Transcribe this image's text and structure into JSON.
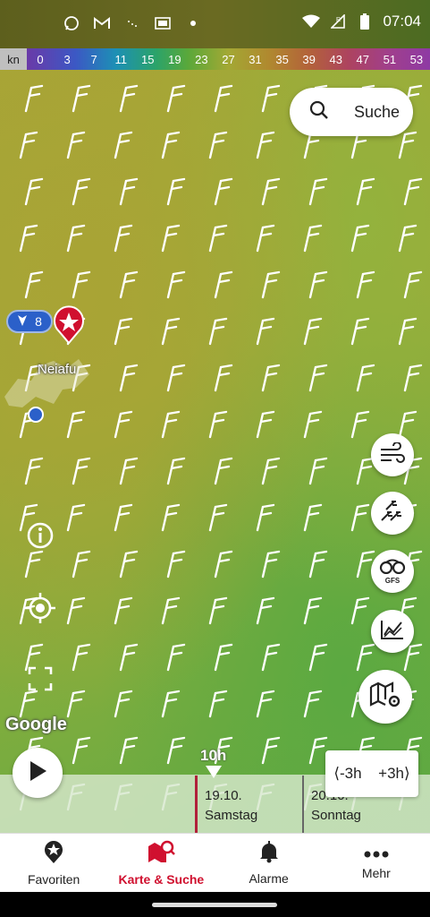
{
  "status_bar": {
    "time": "07:04",
    "icons": [
      "whatsapp-icon",
      "gmail-icon",
      "dots-icon",
      "gb-icon",
      "dot-icon"
    ],
    "right_icons": [
      "wifi-icon",
      "signal-icon",
      "battery-icon"
    ]
  },
  "scale": {
    "unit": "kn",
    "values": [
      "0",
      "3",
      "7",
      "11",
      "15",
      "19",
      "23",
      "27",
      "31",
      "35",
      "39",
      "43",
      "47",
      "51",
      "53"
    ]
  },
  "search": {
    "label": "Suche"
  },
  "marker": {
    "count": "8",
    "place": "Neiafu"
  },
  "map_attribution": "Google",
  "fab_buttons": [
    {
      "name": "wind-icon"
    },
    {
      "name": "wind-barbs-icon"
    },
    {
      "name": "model-icon",
      "label": "GFS"
    },
    {
      "name": "chart-icon"
    },
    {
      "name": "map-settings-icon"
    }
  ],
  "timeline": {
    "current_time": "10h",
    "days": [
      {
        "date": "19.10.",
        "weekday": "Samstag"
      },
      {
        "date": "20.10.",
        "weekday": "Sonntag"
      }
    ],
    "step_back": "-3h",
    "step_forward": "+3h"
  },
  "bottom_nav": [
    {
      "label": "Favoriten",
      "icon": "star-pin-icon",
      "active": false
    },
    {
      "label": "Karte & Suche",
      "icon": "map-pin-icon",
      "active": true
    },
    {
      "label": "Alarme",
      "icon": "bell-icon",
      "active": false
    },
    {
      "label": "Mehr",
      "icon": "more-icon",
      "active": false
    }
  ],
  "colors": {
    "accent": "#d0102f",
    "marker_blue": "#2b60c9"
  }
}
